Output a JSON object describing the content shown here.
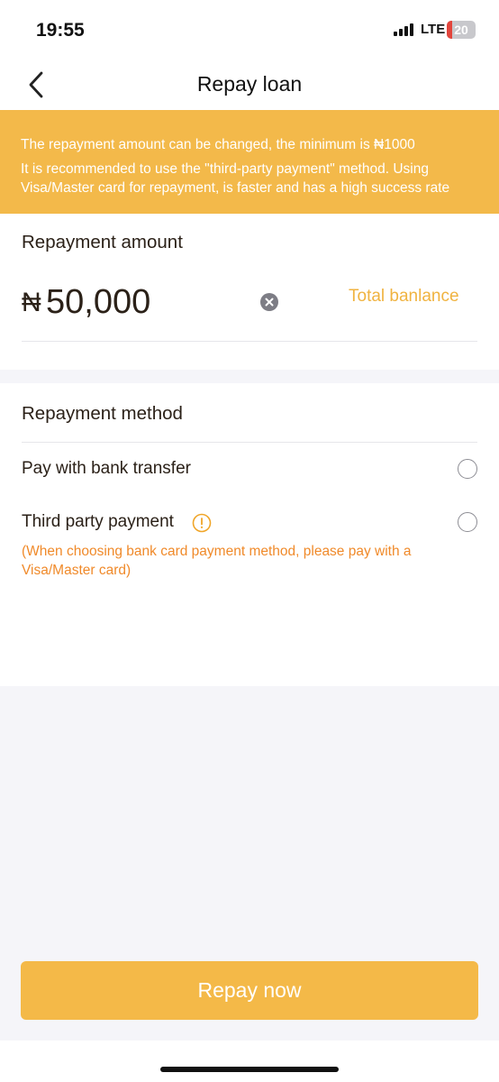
{
  "status_bar": {
    "time": "19:55",
    "network": "LTE",
    "battery": "20",
    "battery_level": 0.2,
    "battery_color": "#e2453c"
  },
  "header": {
    "title": "Repay loan",
    "back_icon": "chevron-left-icon"
  },
  "notice": {
    "line1": "The repayment amount can be changed, the minimum is ₦1000",
    "line2": "It is recommended to use the \"third-party payment\" method. Using Visa/Master card for repayment, is faster and has a high success rate",
    "background": "#f3b94a"
  },
  "amount": {
    "title": "Repayment amount",
    "currency": "₦",
    "value": "50,000",
    "clear_icon": "clear-icon",
    "total_link": "Total banlance"
  },
  "method": {
    "title": "Repayment method",
    "options": [
      {
        "label": "Pay with bank transfer",
        "selected": false
      },
      {
        "label": "Third party payment",
        "selected": false,
        "info_icon": "info-icon"
      }
    ],
    "note": "(When choosing bank card payment method, please pay with a Visa/Master card)"
  },
  "action": {
    "repay_label": "Repay now",
    "accent": "#f4b948"
  }
}
